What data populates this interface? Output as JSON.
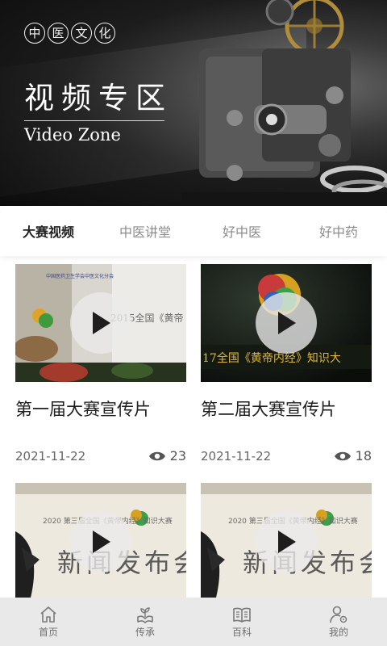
{
  "hero": {
    "seal_chars": [
      "中",
      "医",
      "文",
      "化"
    ],
    "title": "视频专区",
    "subtitle": "Video Zone"
  },
  "tabs": [
    {
      "label": "大赛视频",
      "active": true
    },
    {
      "label": "中医讲堂",
      "active": false
    },
    {
      "label": "好中医",
      "active": false
    },
    {
      "label": "好中药",
      "active": false
    }
  ],
  "videos": [
    {
      "title": "第一届大赛宣传片",
      "date": "2021-11-22",
      "views": "23",
      "thumb_text": "2015全国《黄帝",
      "thumb_header": "中国医药卫生学会中医文化分会"
    },
    {
      "title": "第二届大赛宣传片",
      "date": "2021-11-22",
      "views": "18",
      "thumb_text": "17全国《黄帝内经》知识大"
    },
    {
      "title": "",
      "date": "",
      "views": "",
      "thumb_banner": "2020 第三届全国《黄帝内经》知识大赛",
      "thumb_big": "新闻发布会"
    },
    {
      "title": "",
      "date": "",
      "views": "",
      "thumb_banner": "2020 第三届全国《黄帝内经》知识大赛",
      "thumb_big": "新闻发布会"
    }
  ],
  "bottom_nav": [
    {
      "label": "首页",
      "icon": "home-icon"
    },
    {
      "label": "传承",
      "icon": "sprout-book-icon"
    },
    {
      "label": "百科",
      "icon": "book-icon"
    },
    {
      "label": "我的",
      "icon": "user-settings-icon"
    }
  ],
  "colors": {
    "hero_dark": "#0c0c0c",
    "tab_active": "#222222",
    "tab_inactive": "#8c8c8c",
    "nav_bg": "#e9e9e9",
    "nav_icon": "#7a7a7a"
  }
}
